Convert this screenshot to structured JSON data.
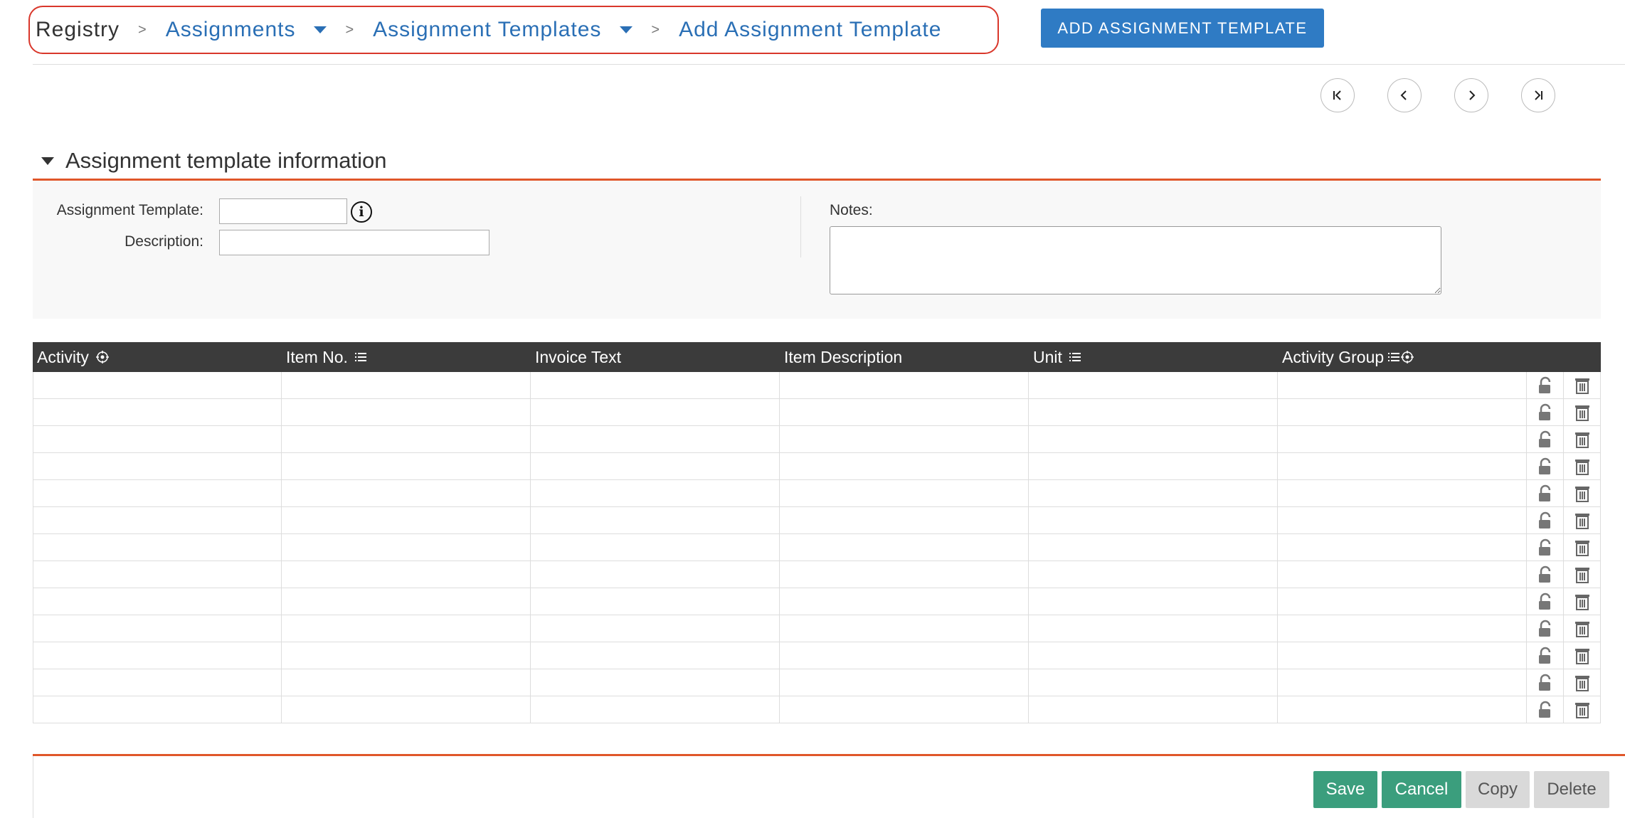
{
  "breadcrumb": {
    "root": "Registry",
    "items": [
      "Assignments",
      "Assignment Templates"
    ],
    "current": "Add Assignment Template",
    "separator": ">"
  },
  "header": {
    "add_button": "ADD ASSIGNMENT TEMPLATE"
  },
  "pager": [
    "first-page-icon",
    "previous-page-icon",
    "next-page-icon",
    "last-page-icon"
  ],
  "section": {
    "title": "Assignment template information",
    "fields": {
      "template_label": "Assignment Template:",
      "template_value": "",
      "description_label": "Description:",
      "description_value": "",
      "notes_label": "Notes:",
      "notes_value": ""
    }
  },
  "grid": {
    "columns": [
      "Activity",
      "Item No.",
      "Invoice Text",
      "Item Description",
      "Unit",
      "Activity Group"
    ],
    "row_count": 13,
    "row_icons": [
      "unlock-icon",
      "trash-icon"
    ]
  },
  "actions": {
    "save": "Save",
    "cancel": "Cancel",
    "copy": "Copy",
    "delete": "Delete"
  },
  "colors": {
    "accent_orange": "#e0572a",
    "primary_blue": "#2f7bc4",
    "save_green": "#3b9e7d",
    "header_dark": "#3b3b3b"
  }
}
